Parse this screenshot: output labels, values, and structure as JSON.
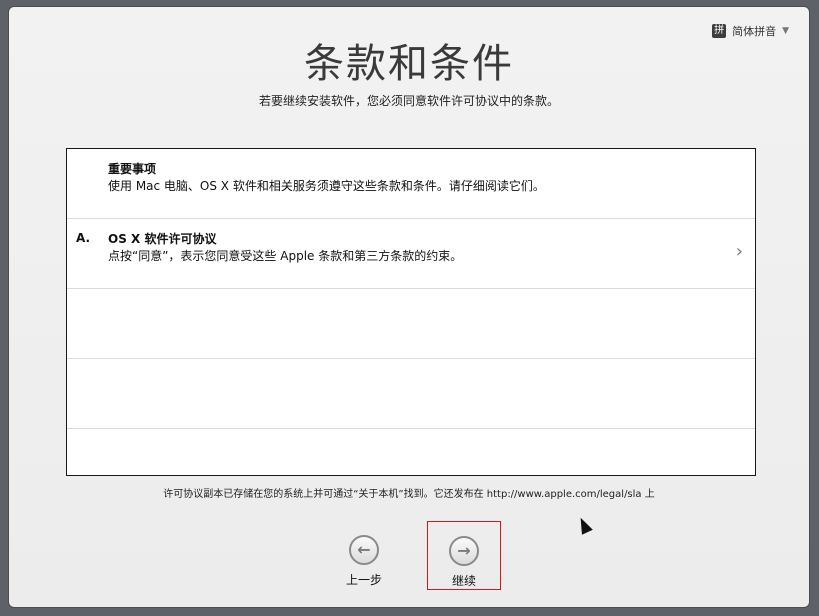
{
  "language_menu": {
    "label": "简体拼音",
    "kb_glyph": "拼"
  },
  "header": {
    "title": "条款和条件",
    "subtitle": "若要继续安装软件，您必须同意软件许可协议中的条款。"
  },
  "list": {
    "rows": [
      {
        "letter": "",
        "heading": "重要事项",
        "description": "使用 Mac 电脑、OS X 软件和相关服务须遵守这些条款和条件。请仔细阅读它们。",
        "has_arrow": false
      },
      {
        "letter": "A.",
        "heading": "OS X 软件许可协议",
        "description": "点按“同意”，表示您同意受这些 Apple 条款和第三方条款的约束。",
        "has_arrow": true
      },
      {
        "letter": "",
        "heading": "",
        "description": "",
        "has_arrow": false
      },
      {
        "letter": "",
        "heading": "",
        "description": "",
        "has_arrow": false
      },
      {
        "letter": "",
        "heading": "",
        "description": "",
        "has_arrow": false
      }
    ]
  },
  "footnote": "许可协议副本已存储在您的系统上并可通过“关于本机”找到。它还发布在 http://www.apple.com/legal/sla 上",
  "nav": {
    "back_label": "上一步",
    "continue_label": "继续"
  },
  "icons": {
    "back": "arrow-left-circle-icon",
    "continue": "arrow-right-circle-icon",
    "row_arrow": "chevron-right-icon"
  }
}
